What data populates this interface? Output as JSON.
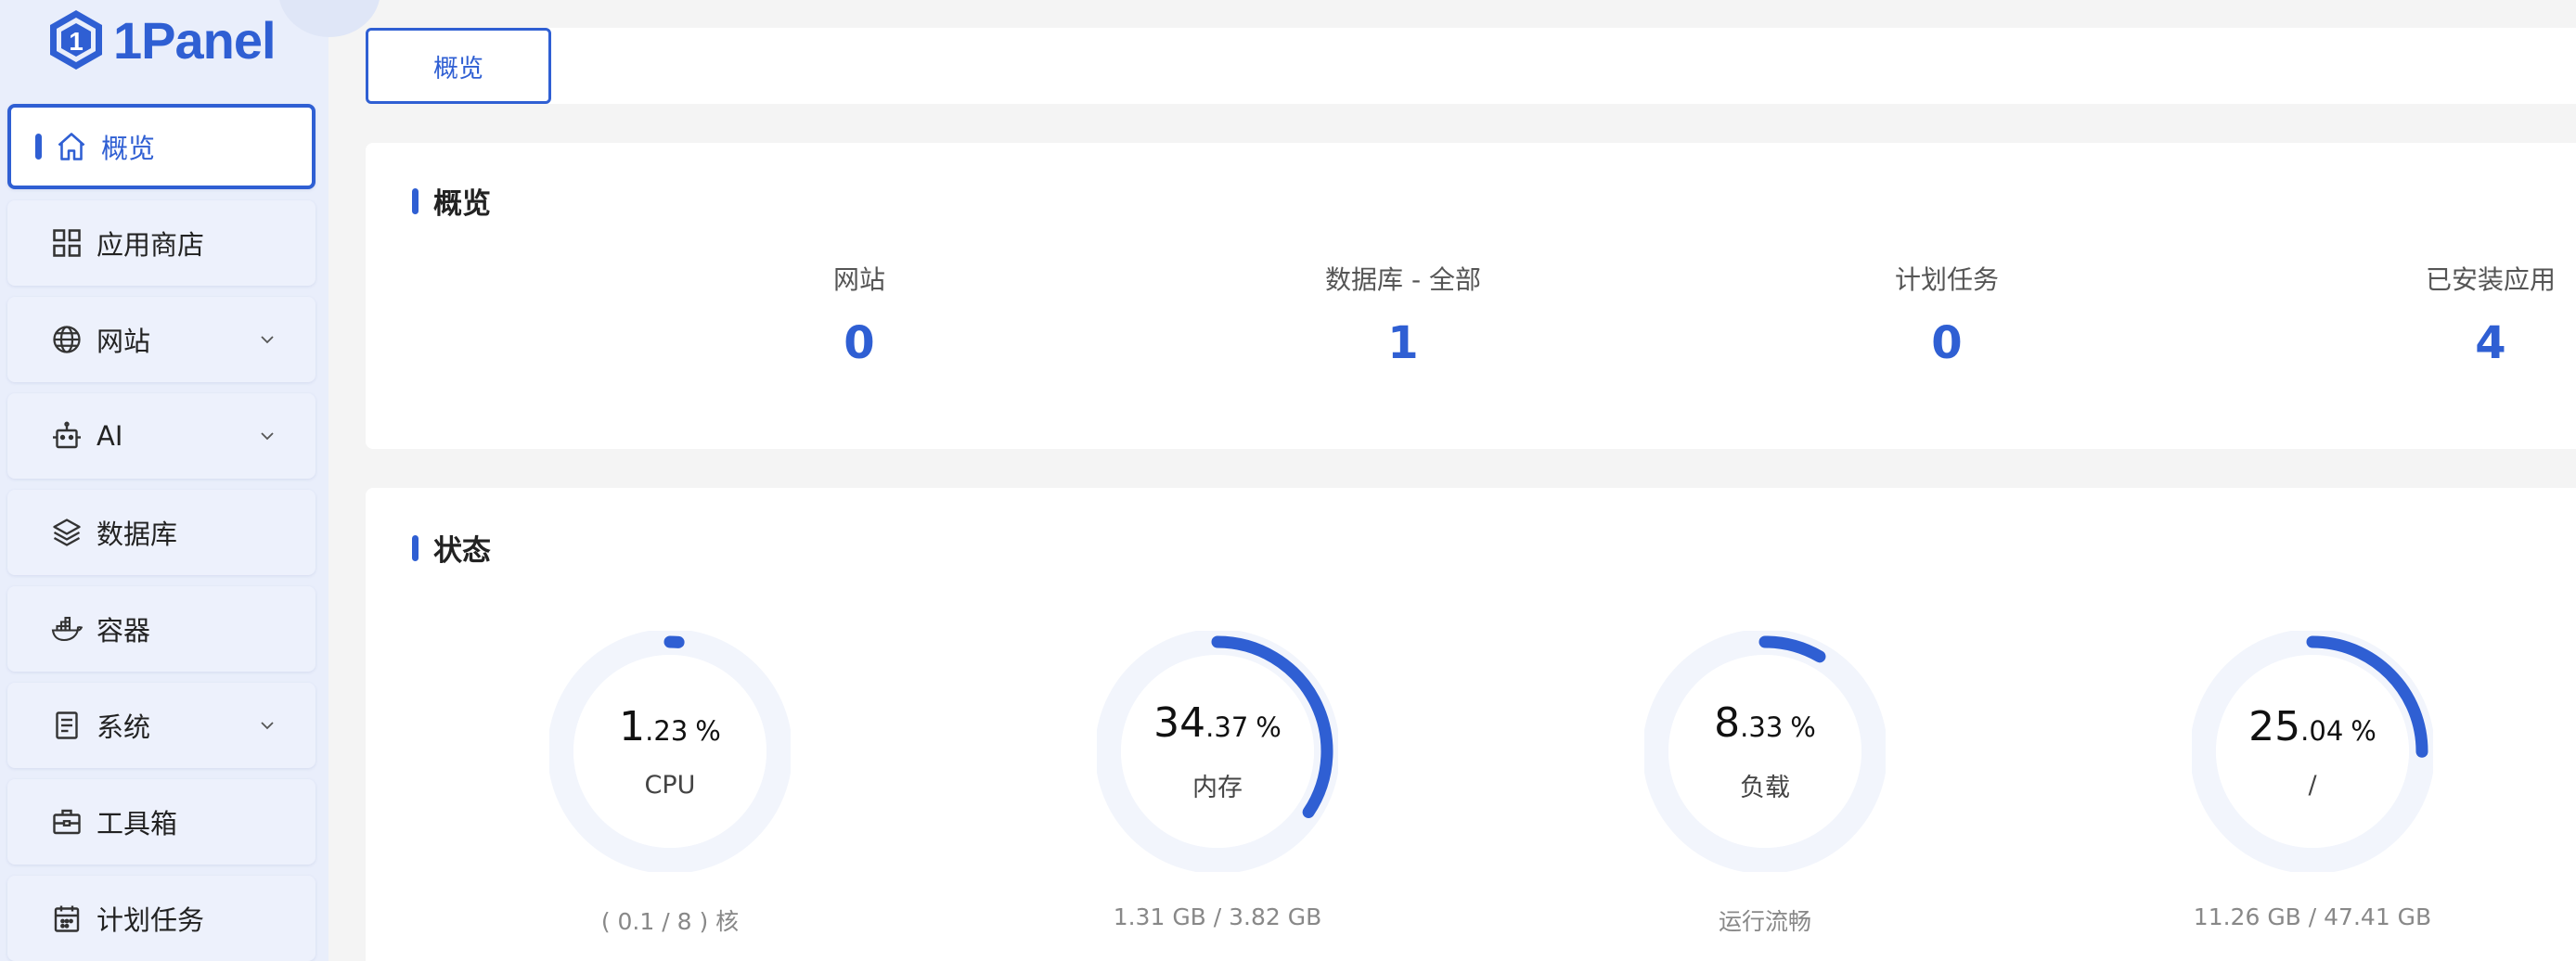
{
  "brand": {
    "name": "1Panel",
    "color": "#2f5fd3"
  },
  "sidebar": {
    "items": [
      {
        "label": "概览",
        "icon": "home-icon",
        "active": true
      },
      {
        "label": "应用商店",
        "icon": "grid-icon"
      },
      {
        "label": "网站",
        "icon": "globe-icon",
        "expandable": true
      },
      {
        "label": "AI",
        "icon": "robot-icon",
        "expandable": true
      },
      {
        "label": "数据库",
        "icon": "layers-icon"
      },
      {
        "label": "容器",
        "icon": "docker-icon"
      },
      {
        "label": "系统",
        "icon": "server-icon",
        "expandable": true
      },
      {
        "label": "工具箱",
        "icon": "toolbox-icon"
      },
      {
        "label": "计划任务",
        "icon": "calendar-icon"
      }
    ]
  },
  "tabs": [
    {
      "label": "概览"
    }
  ],
  "overview": {
    "title": "概览",
    "stats": [
      {
        "label": "网站",
        "value": "0"
      },
      {
        "label": "数据库 - 全部",
        "value": "1"
      },
      {
        "label": "计划任务",
        "value": "0"
      },
      {
        "label": "已安装应用",
        "value": "4"
      }
    ]
  },
  "status": {
    "title": "状态",
    "gauges": [
      {
        "int": "1",
        "dec": ".23",
        "unit": "%",
        "percent": 1.23,
        "name": "CPU",
        "footer": "( 0.1 / 8 ) 核"
      },
      {
        "int": "34",
        "dec": ".37",
        "unit": "%",
        "percent": 34.37,
        "name": "内存",
        "footer": "1.31 GB / 3.82 GB"
      },
      {
        "int": "8",
        "dec": ".33",
        "unit": "%",
        "percent": 8.33,
        "name": "负载",
        "footer": "运行流畅"
      },
      {
        "int": "25",
        "dec": ".04",
        "unit": "%",
        "percent": 25.04,
        "name": "/",
        "footer": "11.26 GB / 47.41 GB"
      }
    ]
  },
  "colors": {
    "accent": "#2f5fd3",
    "gauge_track": "#f2f5fc",
    "sidebar_bg": "#e9eefb"
  }
}
